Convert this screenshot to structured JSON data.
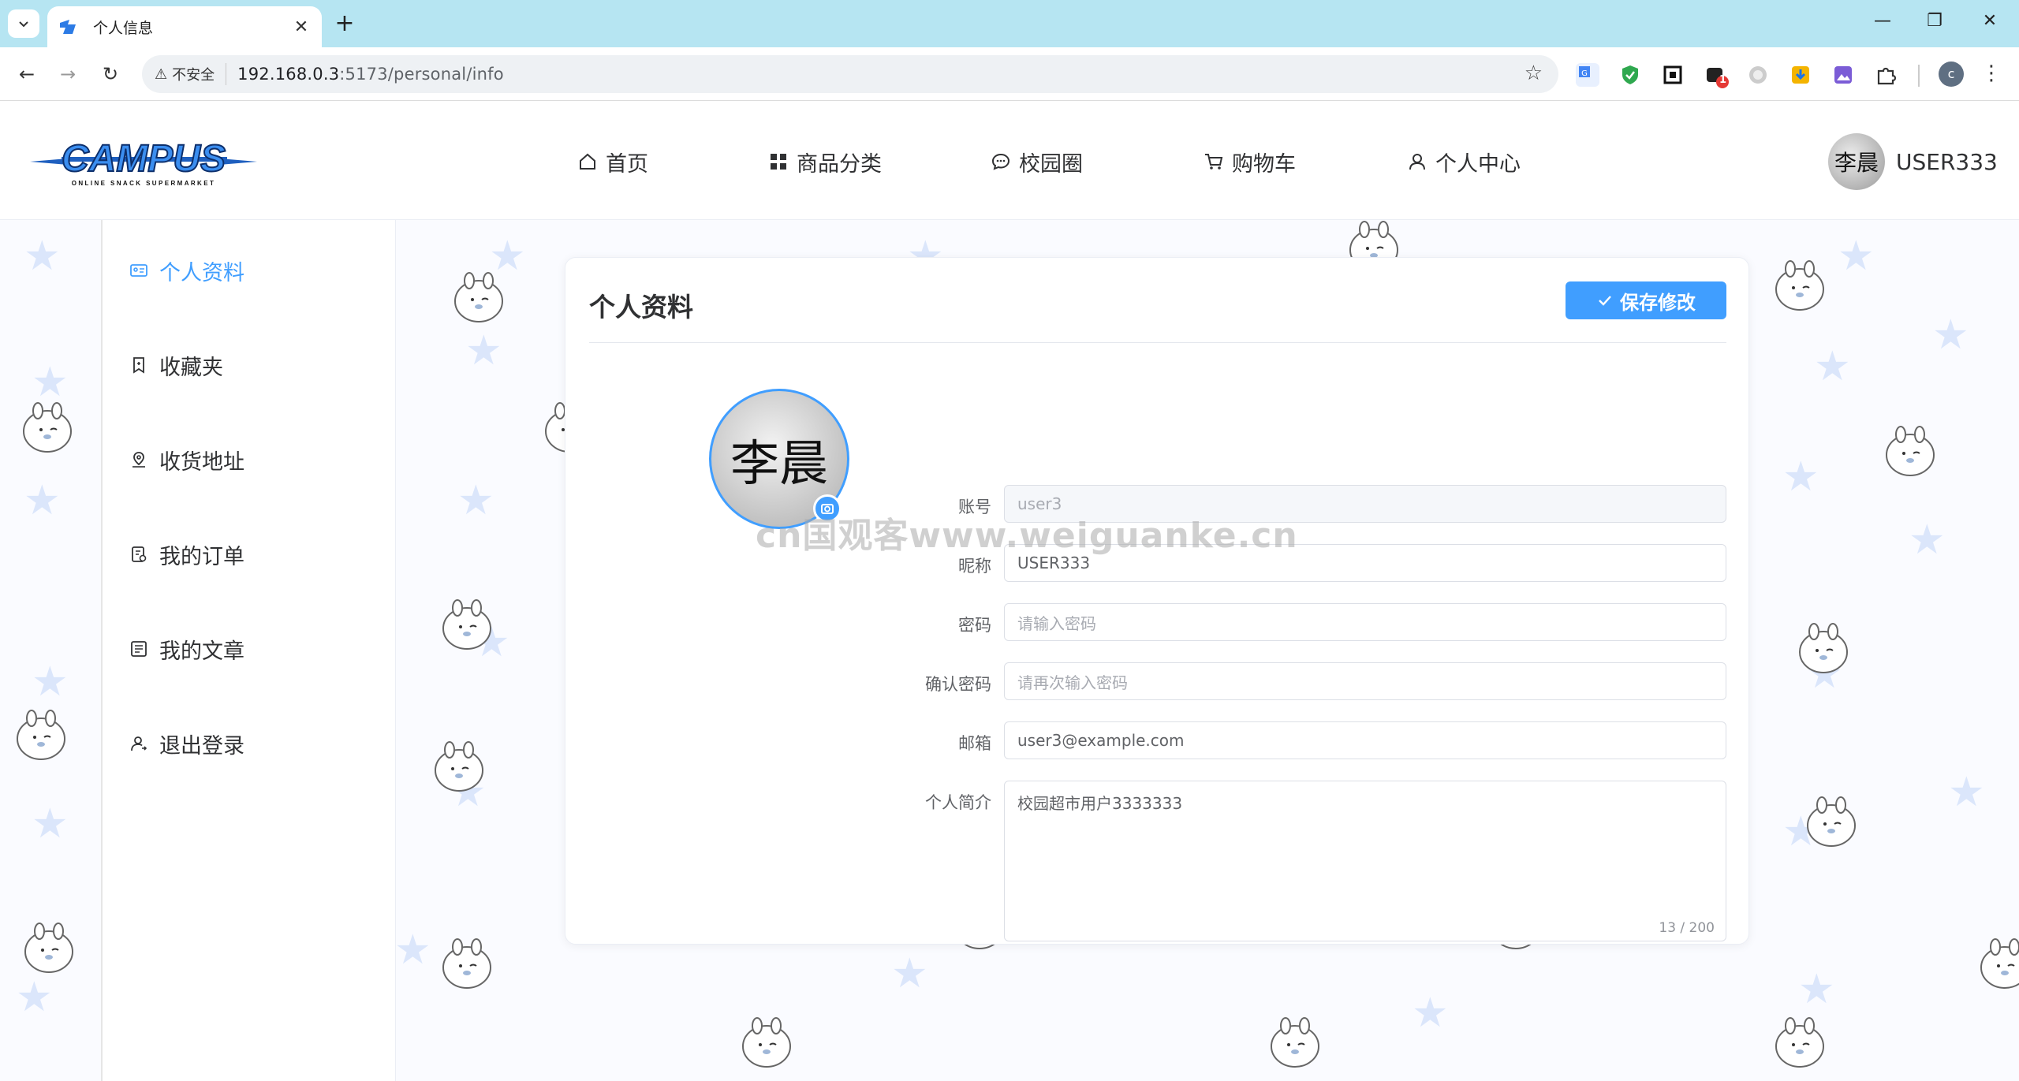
{
  "browser": {
    "tab_title": "个人信息",
    "security_label": "不安全",
    "url_host": "192.168.0.3",
    "url_path": ":5173/personal/info",
    "ext_badge": "1",
    "profile_initial": "c"
  },
  "header": {
    "logo_text": "CAMPUS",
    "logo_subtitle": "ONLINE SNACK SUPERMARKET",
    "nav": [
      {
        "label": "首页",
        "icon": "home-icon"
      },
      {
        "label": "商品分类",
        "icon": "grid-icon"
      },
      {
        "label": "校园圈",
        "icon": "chat-bubble-icon"
      },
      {
        "label": "购物车",
        "icon": "cart-icon"
      },
      {
        "label": "个人中心",
        "icon": "user-icon"
      }
    ],
    "user_name": "USER333",
    "avatar_text": "李晨"
  },
  "sidebar": {
    "items": [
      {
        "label": "个人资料",
        "icon": "id-card-icon",
        "active": true
      },
      {
        "label": "收藏夹",
        "icon": "bookmark-icon"
      },
      {
        "label": "收货地址",
        "icon": "location-icon"
      },
      {
        "label": "我的订单",
        "icon": "order-icon"
      },
      {
        "label": "我的文章",
        "icon": "document-icon"
      },
      {
        "label": "退出登录",
        "icon": "logout-user-icon"
      }
    ]
  },
  "profile": {
    "title": "个人资料",
    "save_label": "保存修改",
    "avatar_text": "李晨",
    "fields": {
      "account": {
        "label": "账号",
        "value": "user3"
      },
      "nickname": {
        "label": "昵称",
        "value": "USER333"
      },
      "password": {
        "label": "密码",
        "placeholder": "请输入密码"
      },
      "confirm": {
        "label": "确认密码",
        "placeholder": "请再次输入密码"
      },
      "email": {
        "label": "邮箱",
        "value": "user3@example.com"
      },
      "bio": {
        "label": "个人简介",
        "value": "校园超市用户3333333",
        "counter": "13 / 200"
      }
    }
  },
  "watermark": "cn国观客www.weiguanke.cn",
  "colors": {
    "accent": "#409eff",
    "tabbar": "#b6e5f2"
  }
}
